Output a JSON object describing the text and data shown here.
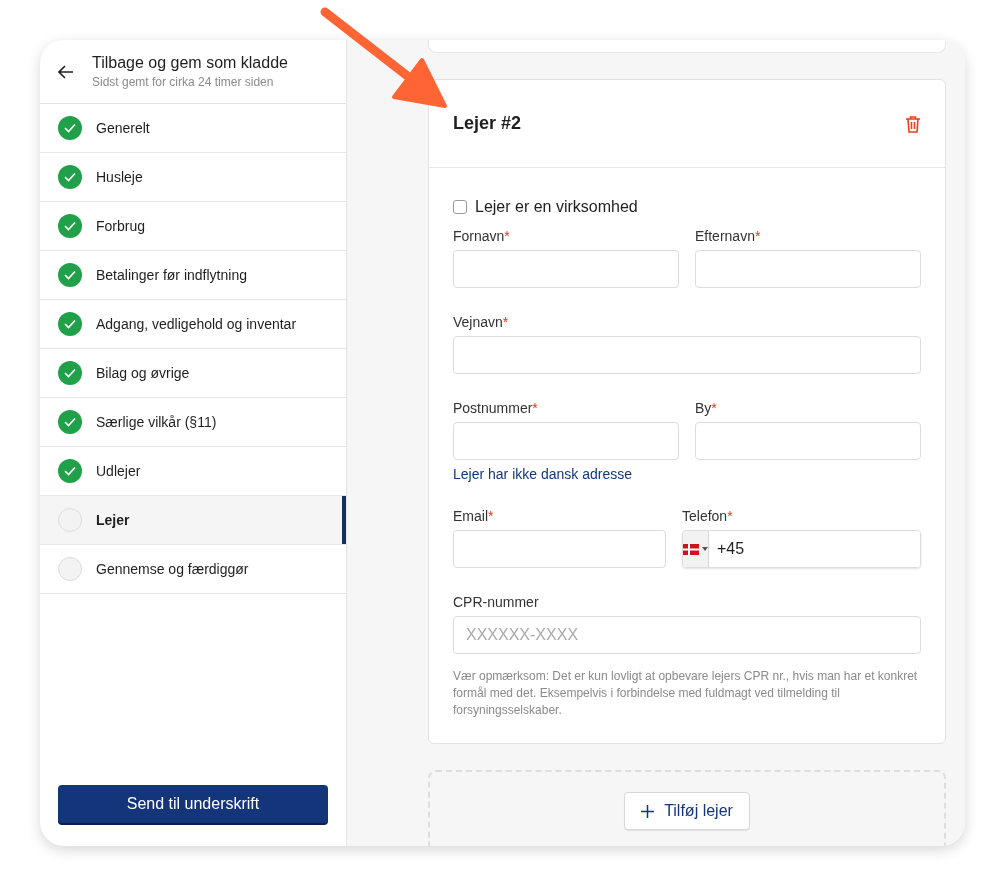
{
  "sidebar": {
    "back_title": "Tilbage og gem som kladde",
    "saved_note": "Sidst gemt for cirka 24 timer siden",
    "steps": [
      {
        "label": "Generelt",
        "completed": true,
        "selected": false
      },
      {
        "label": "Husleje",
        "completed": true,
        "selected": false
      },
      {
        "label": "Forbrug",
        "completed": true,
        "selected": false
      },
      {
        "label": "Betalinger før indflytning",
        "completed": true,
        "selected": false
      },
      {
        "label": "Adgang, vedligehold og inventar",
        "completed": true,
        "selected": false
      },
      {
        "label": "Bilag og øvrige",
        "completed": true,
        "selected": false
      },
      {
        "label": "Særlige vilkår (§11)",
        "completed": true,
        "selected": false
      },
      {
        "label": "Udlejer",
        "completed": true,
        "selected": false
      },
      {
        "label": "Lejer",
        "completed": false,
        "selected": true
      },
      {
        "label": "Gennemse og færdiggør",
        "completed": false,
        "selected": false
      }
    ],
    "submit_button": "Send til underskrift"
  },
  "tenant_card": {
    "title": "Lejer #2",
    "company_checkbox": {
      "label": "Lejer er en virksomhed",
      "checked": false
    },
    "rows": [
      {
        "fields": [
          {
            "kind": "text",
            "label": "Fornavn",
            "required_mark": "*"
          },
          {
            "kind": "text",
            "label": "Efternavn",
            "required_mark": "*"
          }
        ]
      },
      {
        "fields": [
          {
            "kind": "text",
            "label": "Vejnavn",
            "required_mark": "*"
          }
        ]
      },
      {
        "fields": [
          {
            "kind": "text",
            "label": "Postnummer",
            "required_mark": "*"
          },
          {
            "kind": "text",
            "label": "By",
            "required_mark": "*"
          }
        ],
        "link": "Lejer har ikke dansk adresse"
      },
      {
        "fields": [
          {
            "kind": "email",
            "label": "Email",
            "required_mark": "*"
          },
          {
            "kind": "phone",
            "label": "Telefon",
            "required_mark": "*",
            "value": "+45"
          }
        ]
      },
      {
        "fields": [
          {
            "kind": "text",
            "label": "CPR-nummer",
            "placeholder": "XXXXXX-XXXX"
          }
        ],
        "note": "Vær opmærksom: Det er kun lovligt at opbevare lejers CPR nr., hvis man har et konkret formål med det. Eksempelvis i forbindelse med fuldmagt ved tilmelding til forsyningsselskaber."
      }
    ]
  },
  "add_button": "Tilføj lejer"
}
